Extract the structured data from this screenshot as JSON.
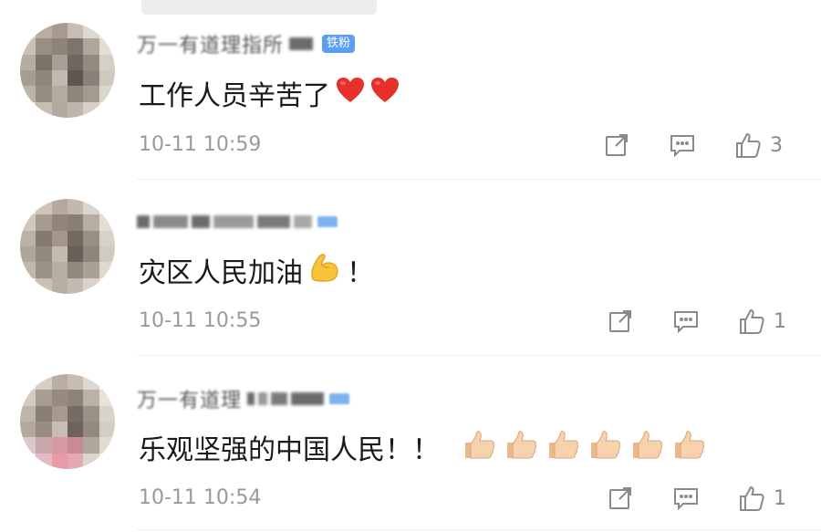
{
  "comments": [
    {
      "name_fragment": "万一有道理指所",
      "badge": "铁粉",
      "text": "工作人员辛苦了",
      "emojis": [
        "heart-emoji",
        "heart-emoji"
      ],
      "time": "10-11 10:59",
      "likes": "3"
    },
    {
      "name_fragment": "",
      "badge": "",
      "text": "灾区人民加油",
      "emojis": [
        "flexed-biceps-emoji"
      ],
      "suffix": "！",
      "time": "10-11 10:55",
      "likes": "1"
    },
    {
      "name_fragment": "万一有道理",
      "badge": "",
      "text": "乐观坚强的中国人民！！",
      "emojis": [
        "thumbs-up-emoji",
        "thumbs-up-emoji",
        "thumbs-up-emoji",
        "thumbs-up-emoji",
        "thumbs-up-emoji",
        "thumbs-up-emoji"
      ],
      "time": "10-11 10:54",
      "likes": "1"
    }
  ],
  "colors": {
    "text": "#1a1a1a",
    "meta": "#9a9a9a",
    "badge": "#5b9ff2",
    "icon": "#8a8a8a"
  }
}
